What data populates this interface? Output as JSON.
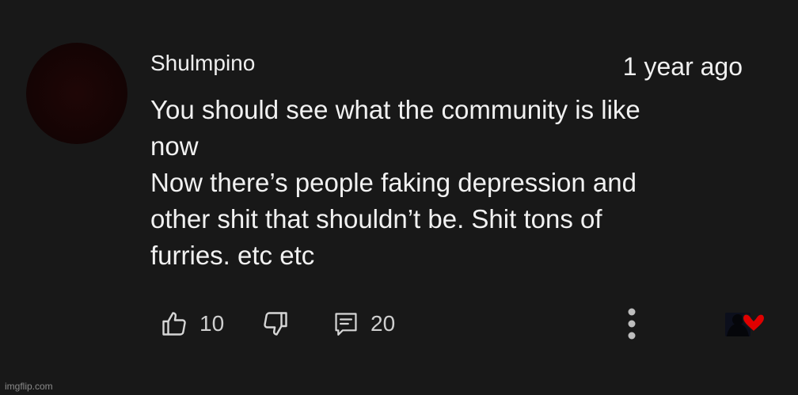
{
  "comment": {
    "author": "Shulmpino",
    "timestamp": "1 year ago",
    "lines": [
      "You should  see what the community is like",
      "now",
      "Now there’s people faking depression and",
      "other shit that shouldn’t be. Shit tons of",
      "furries. etc etc"
    ]
  },
  "actions": {
    "like_icon": "thumb-up-icon",
    "like_count": "10",
    "dislike_icon": "thumb-down-icon",
    "reply_icon": "comment-reply-icon",
    "reply_count": "20",
    "more_icon": "vertical-dots-icon",
    "creator_heart_icon": "creator-heart-icon"
  },
  "colors": {
    "background": "#181818",
    "text": "#f1f1f1",
    "secondary_text": "#cfcfcf",
    "heart": "#e00000"
  },
  "watermark": "imgflip.com"
}
